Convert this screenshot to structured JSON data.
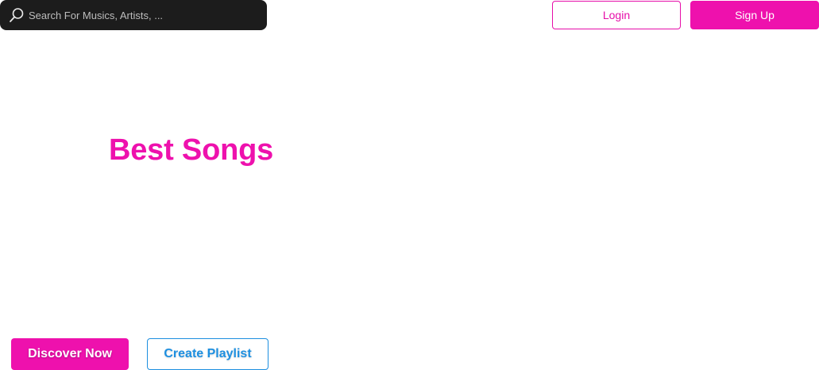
{
  "header": {
    "search": {
      "placeholder": "Search For Musics, Artists, ...",
      "value": "",
      "icon": "search-icon"
    },
    "login_label": "Login",
    "signup_label": "Sign Up"
  },
  "hero": {
    "title": "Best Songs"
  },
  "actions": {
    "discover_label": "Discover Now",
    "create_playlist_label": "Create Playlist"
  },
  "colors": {
    "accent_pink": "#ee11ad",
    "accent_blue": "#1d8fe0",
    "search_bg": "#1c1c1c"
  }
}
